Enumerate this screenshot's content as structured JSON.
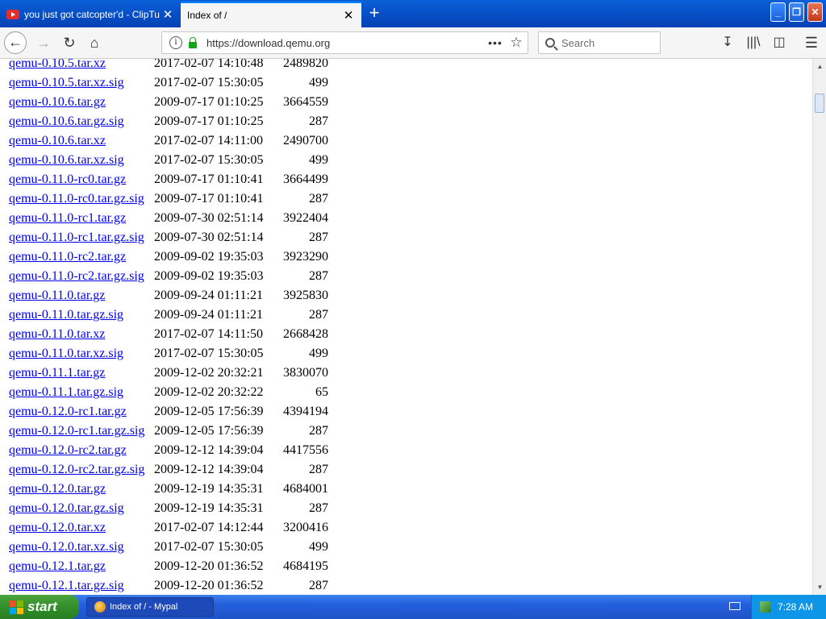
{
  "browser": {
    "tabs": [
      {
        "title": "you just got catcopter'd - ClipTube",
        "icon": "youtube-icon",
        "active": false
      },
      {
        "title": "Index of /",
        "icon": "",
        "active": true
      }
    ],
    "new_tab": "+",
    "window_buttons": {
      "minimize": "_",
      "maximize": "❐",
      "close": "✕"
    },
    "url": "https://download.qemu.org",
    "search_placeholder": "Search"
  },
  "listing": [
    {
      "name": "qemu-0.10.5.tar.xz",
      "date": "2017-02-07 14:10:48",
      "size": "2489820"
    },
    {
      "name": "qemu-0.10.5.tar.xz.sig",
      "date": "2017-02-07 15:30:05",
      "size": "499"
    },
    {
      "name": "qemu-0.10.6.tar.gz",
      "date": "2009-07-17 01:10:25",
      "size": "3664559"
    },
    {
      "name": "qemu-0.10.6.tar.gz.sig",
      "date": "2009-07-17 01:10:25",
      "size": "287"
    },
    {
      "name": "qemu-0.10.6.tar.xz",
      "date": "2017-02-07 14:11:00",
      "size": "2490700"
    },
    {
      "name": "qemu-0.10.6.tar.xz.sig",
      "date": "2017-02-07 15:30:05",
      "size": "499"
    },
    {
      "name": "qemu-0.11.0-rc0.tar.gz",
      "date": "2009-07-17 01:10:41",
      "size": "3664499"
    },
    {
      "name": "qemu-0.11.0-rc0.tar.gz.sig",
      "date": "2009-07-17 01:10:41",
      "size": "287"
    },
    {
      "name": "qemu-0.11.0-rc1.tar.gz",
      "date": "2009-07-30 02:51:14",
      "size": "3922404"
    },
    {
      "name": "qemu-0.11.0-rc1.tar.gz.sig",
      "date": "2009-07-30 02:51:14",
      "size": "287"
    },
    {
      "name": "qemu-0.11.0-rc2.tar.gz",
      "date": "2009-09-02 19:35:03",
      "size": "3923290"
    },
    {
      "name": "qemu-0.11.0-rc2.tar.gz.sig",
      "date": "2009-09-02 19:35:03",
      "size": "287"
    },
    {
      "name": "qemu-0.11.0.tar.gz",
      "date": "2009-09-24 01:11:21",
      "size": "3925830"
    },
    {
      "name": "qemu-0.11.0.tar.gz.sig",
      "date": "2009-09-24 01:11:21",
      "size": "287"
    },
    {
      "name": "qemu-0.11.0.tar.xz",
      "date": "2017-02-07 14:11:50",
      "size": "2668428"
    },
    {
      "name": "qemu-0.11.0.tar.xz.sig",
      "date": "2017-02-07 15:30:05",
      "size": "499"
    },
    {
      "name": "qemu-0.11.1.tar.gz",
      "date": "2009-12-02 20:32:21",
      "size": "3830070"
    },
    {
      "name": "qemu-0.11.1.tar.gz.sig",
      "date": "2009-12-02 20:32:22",
      "size": "65"
    },
    {
      "name": "qemu-0.12.0-rc1.tar.gz",
      "date": "2009-12-05 17:56:39",
      "size": "4394194"
    },
    {
      "name": "qemu-0.12.0-rc1.tar.gz.sig",
      "date": "2009-12-05 17:56:39",
      "size": "287"
    },
    {
      "name": "qemu-0.12.0-rc2.tar.gz",
      "date": "2009-12-12 14:39:04",
      "size": "4417556"
    },
    {
      "name": "qemu-0.12.0-rc2.tar.gz.sig",
      "date": "2009-12-12 14:39:04",
      "size": "287"
    },
    {
      "name": "qemu-0.12.0.tar.gz",
      "date": "2009-12-19 14:35:31",
      "size": "4684001"
    },
    {
      "name": "qemu-0.12.0.tar.gz.sig",
      "date": "2009-12-19 14:35:31",
      "size": "287"
    },
    {
      "name": "qemu-0.12.0.tar.xz",
      "date": "2017-02-07 14:12:44",
      "size": "3200416"
    },
    {
      "name": "qemu-0.12.0.tar.xz.sig",
      "date": "2017-02-07 15:30:05",
      "size": "499"
    },
    {
      "name": "qemu-0.12.1.tar.gz",
      "date": "2009-12-20 01:36:52",
      "size": "4684195"
    },
    {
      "name": "qemu-0.12.1.tar.gz.sig",
      "date": "2009-12-20 01:36:52",
      "size": "287"
    }
  ],
  "taskbar": {
    "start_label": "start",
    "task_label": "Index of / - Mypal",
    "clock": "7:28 AM"
  },
  "colors": {
    "link": "#0000ee",
    "taskbar": "#245edb",
    "start": "#2f8c28",
    "titlebar": "#0a5fd8"
  }
}
